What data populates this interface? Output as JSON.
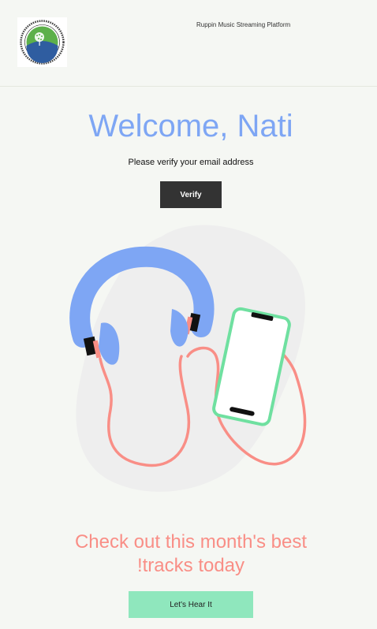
{
  "header": {
    "logo_alt": "Ruppin Academic Center",
    "platform_name": "Ruppin Music Streaming Platform"
  },
  "main": {
    "welcome": "Welcome, Nati",
    "verify_prompt": "Please verify your email address",
    "verify_button": "Verify",
    "cta_line1": "Check out this month's best",
    "cta_line2": "!tracks today",
    "hear_button": "Let's Hear It"
  },
  "colors": {
    "background": "#f5f7f3",
    "welcome": "#7ea6f4",
    "headphones": "#7ea6f4",
    "cable": "#f98e86",
    "phone_frame": "#6fe0a0",
    "cta_text": "#f98e86",
    "verify_button": "#333333",
    "hear_button": "#8fe7bd"
  },
  "icons": {
    "logo": "ruppin-logo-icon",
    "illustration": "headphones-phone-illustration"
  }
}
